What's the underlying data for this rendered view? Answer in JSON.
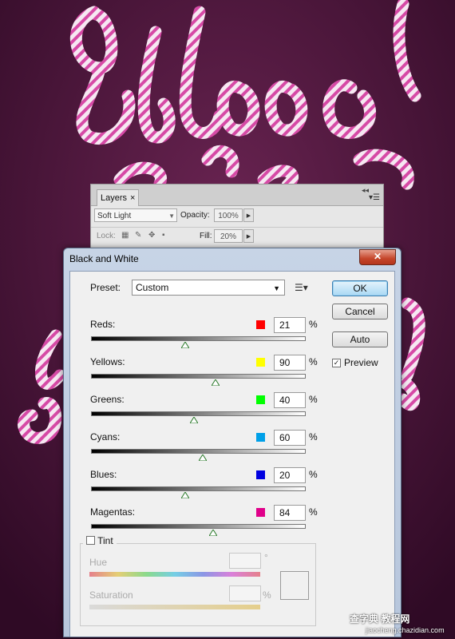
{
  "layers_panel": {
    "tab_label": "Layers",
    "close_glyph": "×",
    "blend_mode": "Soft Light",
    "opacity_label": "Opacity:",
    "opacity_value": "100%",
    "lock_label": "Lock:",
    "fill_label": "Fill:",
    "fill_value": "20%"
  },
  "dialog": {
    "title": "Black and White",
    "close_glyph": "✕",
    "preset_label": "Preset:",
    "preset_value": "Custom",
    "sliders": [
      {
        "label": "Reds:",
        "value": "21",
        "color": "#ff0000",
        "position": 0.44
      },
      {
        "label": "Yellows:",
        "value": "90",
        "color": "#ffff00",
        "position": 0.58
      },
      {
        "label": "Greens:",
        "value": "40",
        "color": "#00ff00",
        "position": 0.48
      },
      {
        "label": "Cyans:",
        "value": "60",
        "color": "#00a0e8",
        "position": 0.52
      },
      {
        "label": "Blues:",
        "value": "20",
        "color": "#0000e0",
        "position": 0.44
      },
      {
        "label": "Magentas:",
        "value": "84",
        "color": "#e0008a",
        "position": 0.57
      }
    ],
    "percent": "%",
    "buttons": {
      "ok": "OK",
      "cancel": "Cancel",
      "auto": "Auto"
    },
    "preview_label": "Preview",
    "preview_checked": true,
    "tint_label": "Tint",
    "tint_checked": false,
    "hue_label": "Hue",
    "hue_unit": "°",
    "saturation_label": "Saturation",
    "saturation_unit": "%"
  },
  "watermark": {
    "line1": "查字典 教程网",
    "line2": "jiaocheng.chazidian.com"
  }
}
